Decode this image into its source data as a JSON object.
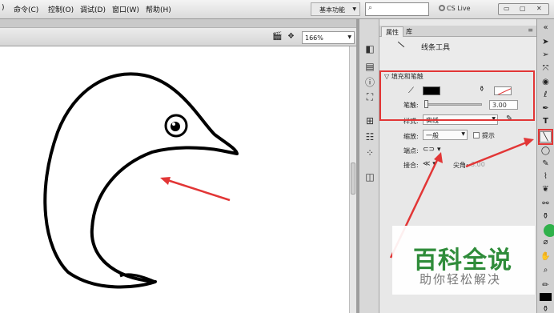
{
  "menu": {
    "items": [
      "命令(C)",
      "控制(O)",
      "调试(D)",
      "窗口(W)",
      "帮助(H)"
    ],
    "first_fragment": ")"
  },
  "workspace": {
    "label": "基本功能"
  },
  "search": {
    "placeholder": ""
  },
  "cs_live": {
    "label": "CS Live"
  },
  "window_controls": {
    "minimize": "▭",
    "restore": "▢",
    "close": "✕"
  },
  "docbar": {
    "zoom": "166%"
  },
  "properties": {
    "tabs": [
      "属性",
      "库"
    ],
    "tool_name": "线条工具",
    "section": "▽ 填充和笔触",
    "stroke_label": "笔触:",
    "stroke_value": "3.00",
    "style_label": "样式:",
    "style_value": "实线",
    "scale_label": "缩放:",
    "scale_value": "一般",
    "hint_label": "提示",
    "cap_label": "端点:",
    "join_label": "接合:",
    "miter_label": "尖角:",
    "miter_value": "3.00"
  },
  "watermark": {
    "title": "百科全说",
    "subtitle": "助你轻松解决"
  },
  "colors": {
    "highlight_red": "#e23636",
    "stroke_color": "#000000",
    "watermark_green": "#2f8c3a"
  },
  "icons": {
    "tools": [
      "selection-arrow-icon",
      "subselect-icon",
      "free-transform-icon",
      "3d-rotation-icon",
      "lasso-icon",
      "pen-icon",
      "text-icon",
      "line-tool-icon",
      "oval-icon",
      "pencil-icon",
      "brush-icon",
      "deco-icon",
      "bone-icon",
      "paint-bucket-icon",
      "eyedropper-icon",
      "eraser-icon",
      "hand-icon",
      "zoom-icon"
    ]
  }
}
